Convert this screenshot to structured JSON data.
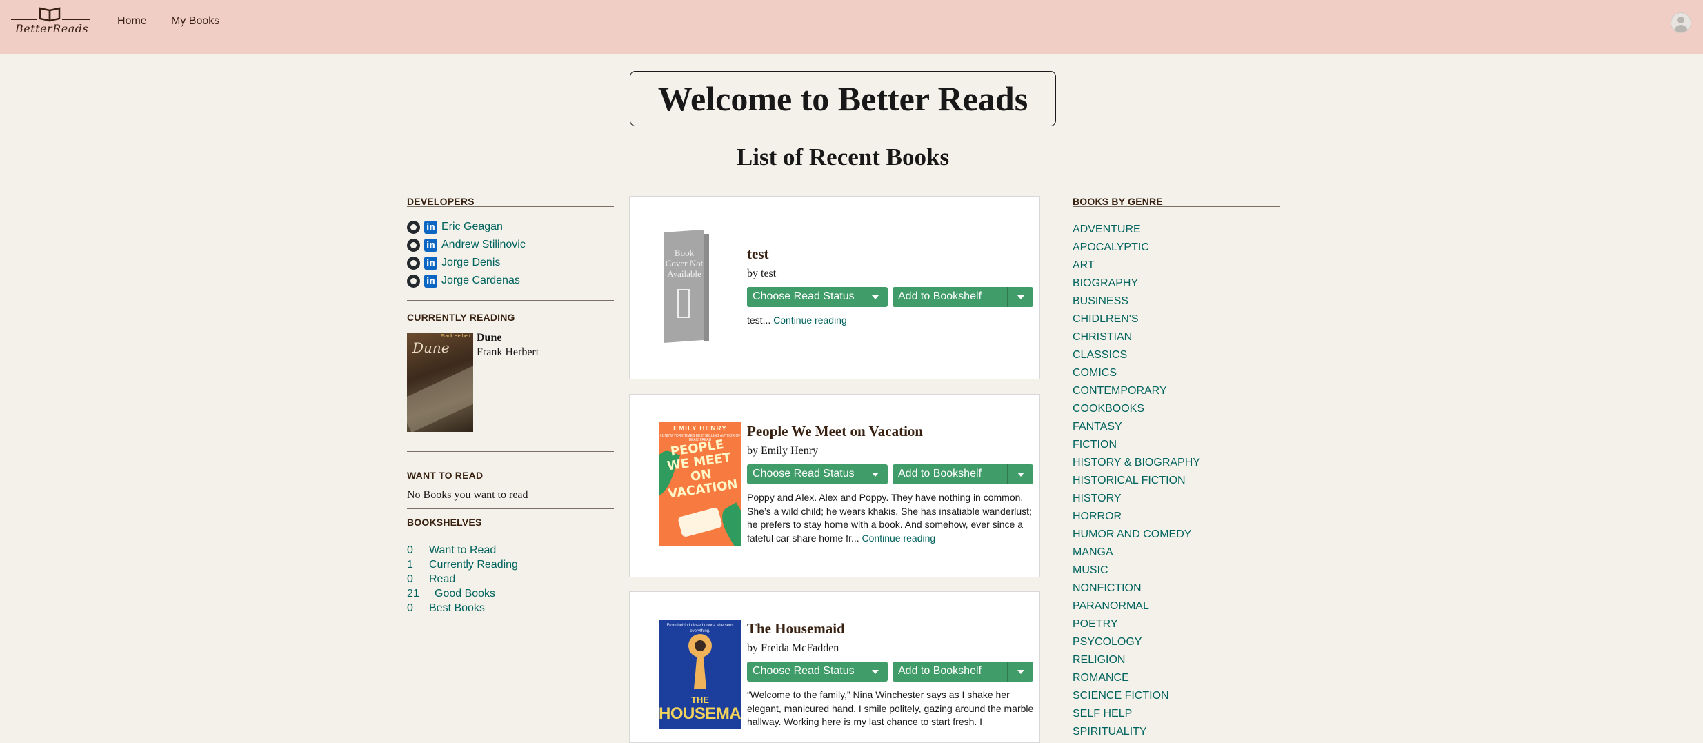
{
  "brand": "BetterReads",
  "nav": {
    "home": "Home",
    "my_books": "My Books"
  },
  "welcome_title": "Welcome to Better Reads",
  "list_title": "List of Recent Books",
  "developers": {
    "heading": "DEVELOPERS",
    "names": [
      "Eric Geagan",
      "Andrew Stilinovic",
      "Jorge Denis",
      "Jorge Cardenas"
    ]
  },
  "currently_reading": {
    "heading": "CURRENTLY READING",
    "title": "Dune",
    "author": "Frank Herbert",
    "cover_title": "Dune",
    "cover_author": "Frank Herbert"
  },
  "want_to_read": {
    "heading": "WANT TO READ",
    "empty_text": "No Books you want to read"
  },
  "bookshelves": {
    "heading": "BOOKSHELVES",
    "items": [
      {
        "count": "0",
        "label": "Want to Read"
      },
      {
        "count": "1",
        "label": "Currently Reading"
      },
      {
        "count": "0",
        "label": "Read"
      },
      {
        "count": "21",
        "label": "Good Books"
      },
      {
        "count": "0",
        "label": "Best Books"
      }
    ]
  },
  "buttons": {
    "read_status": "Choose Read Status",
    "bookshelf": "Add to Bookshelf"
  },
  "books": [
    {
      "title": "test",
      "author": "by test",
      "description": "test...",
      "continue": "Continue reading",
      "cover_text": "Book Cover Not Available"
    },
    {
      "title": "People We Meet on Vacation",
      "author": "by Emily Henry",
      "description": "Poppy and Alex. Alex and Poppy. They have nothing in common. She’s a wild child; he wears khakis. She has insatiable wanderlust; he prefers to stay home with a book. And somehow, ever since a fateful car share home fr...",
      "continue": "Continue reading",
      "cover_author": "EMILY HENRY",
      "cover_sub": "#1 NEW YORK TIMES BESTSELLING AUTHOR OF BEACH READ",
      "cover_title": "PEOPLE WE MEET ON VACATION"
    },
    {
      "title": "The Housemaid",
      "author": "by Freida McFadden",
      "description": "“Welcome to the family,” Nina Winchester says as I shake her elegant, manicured hand. I smile politely, gazing around the marble hallway. Working here is my last chance to start fresh. I",
      "continue": "",
      "cover_tagline": "From behind closed doors, she sees everything.",
      "cover_the": "THE",
      "cover_title": "HOUSEMAID"
    }
  ],
  "genres": {
    "heading": "BOOKS BY GENRE",
    "items": [
      "ADVENTURE",
      "APOCALYPTIC",
      "ART",
      "BIOGRAPHY",
      "BUSINESS",
      "CHIDLREN'S",
      "CHRISTIAN",
      "CLASSICS",
      "COMICS",
      "CONTEMPORARY",
      "COOKBOOKS",
      "FANTASY",
      "FICTION",
      "HISTORY & BIOGRAPHY",
      "HISTORICAL FICTION",
      "HISTORY",
      "HORROR",
      "HUMOR AND COMEDY",
      "MANGA",
      "MUSIC",
      "NONFICTION",
      "PARANORMAL",
      "POETRY",
      "PSYCOLOGY",
      "RELIGION",
      "ROMANCE",
      "SCIENCE FICTION",
      "SELF HELP",
      "SPIRITUALITY"
    ]
  },
  "colors": {
    "topbar": "#f0cec6",
    "background": "#f4f1ea",
    "link": "#00635d",
    "button": "#409d69",
    "brown": "#382110"
  },
  "icons": [
    "open-book-logo-icon",
    "user-avatar-icon",
    "github-icon",
    "linkedin-icon",
    "dropdown-caret-icon"
  ]
}
